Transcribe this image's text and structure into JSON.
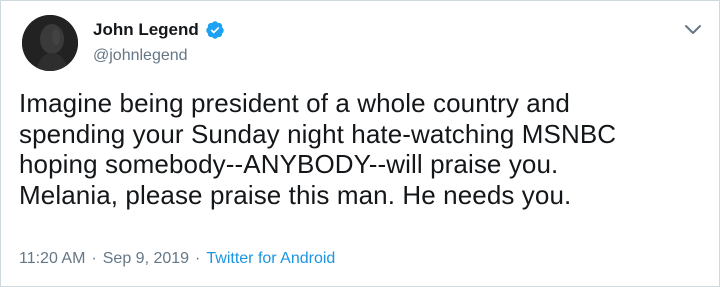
{
  "user": {
    "display_name": "John Legend",
    "handle": "@johnlegend",
    "verified": true,
    "avatar_icon": "profile-photo"
  },
  "tweet": {
    "text": "Imagine being president of a whole country and\nspending your Sunday night hate-watching MSNBC\nhoping somebody--ANYBODY--will praise you.\nMelania, please praise this man.  He needs you."
  },
  "meta": {
    "time": "11:20 AM",
    "separator": "·",
    "date": "Sep 9, 2019",
    "source": "Twitter for Android"
  },
  "colors": {
    "text_primary": "#14171a",
    "text_secondary": "#657786",
    "accent": "#1b95e0",
    "verified": "#1da1f2"
  },
  "icons": {
    "verified": "verified-badge-icon",
    "menu": "chevron-down-icon"
  }
}
